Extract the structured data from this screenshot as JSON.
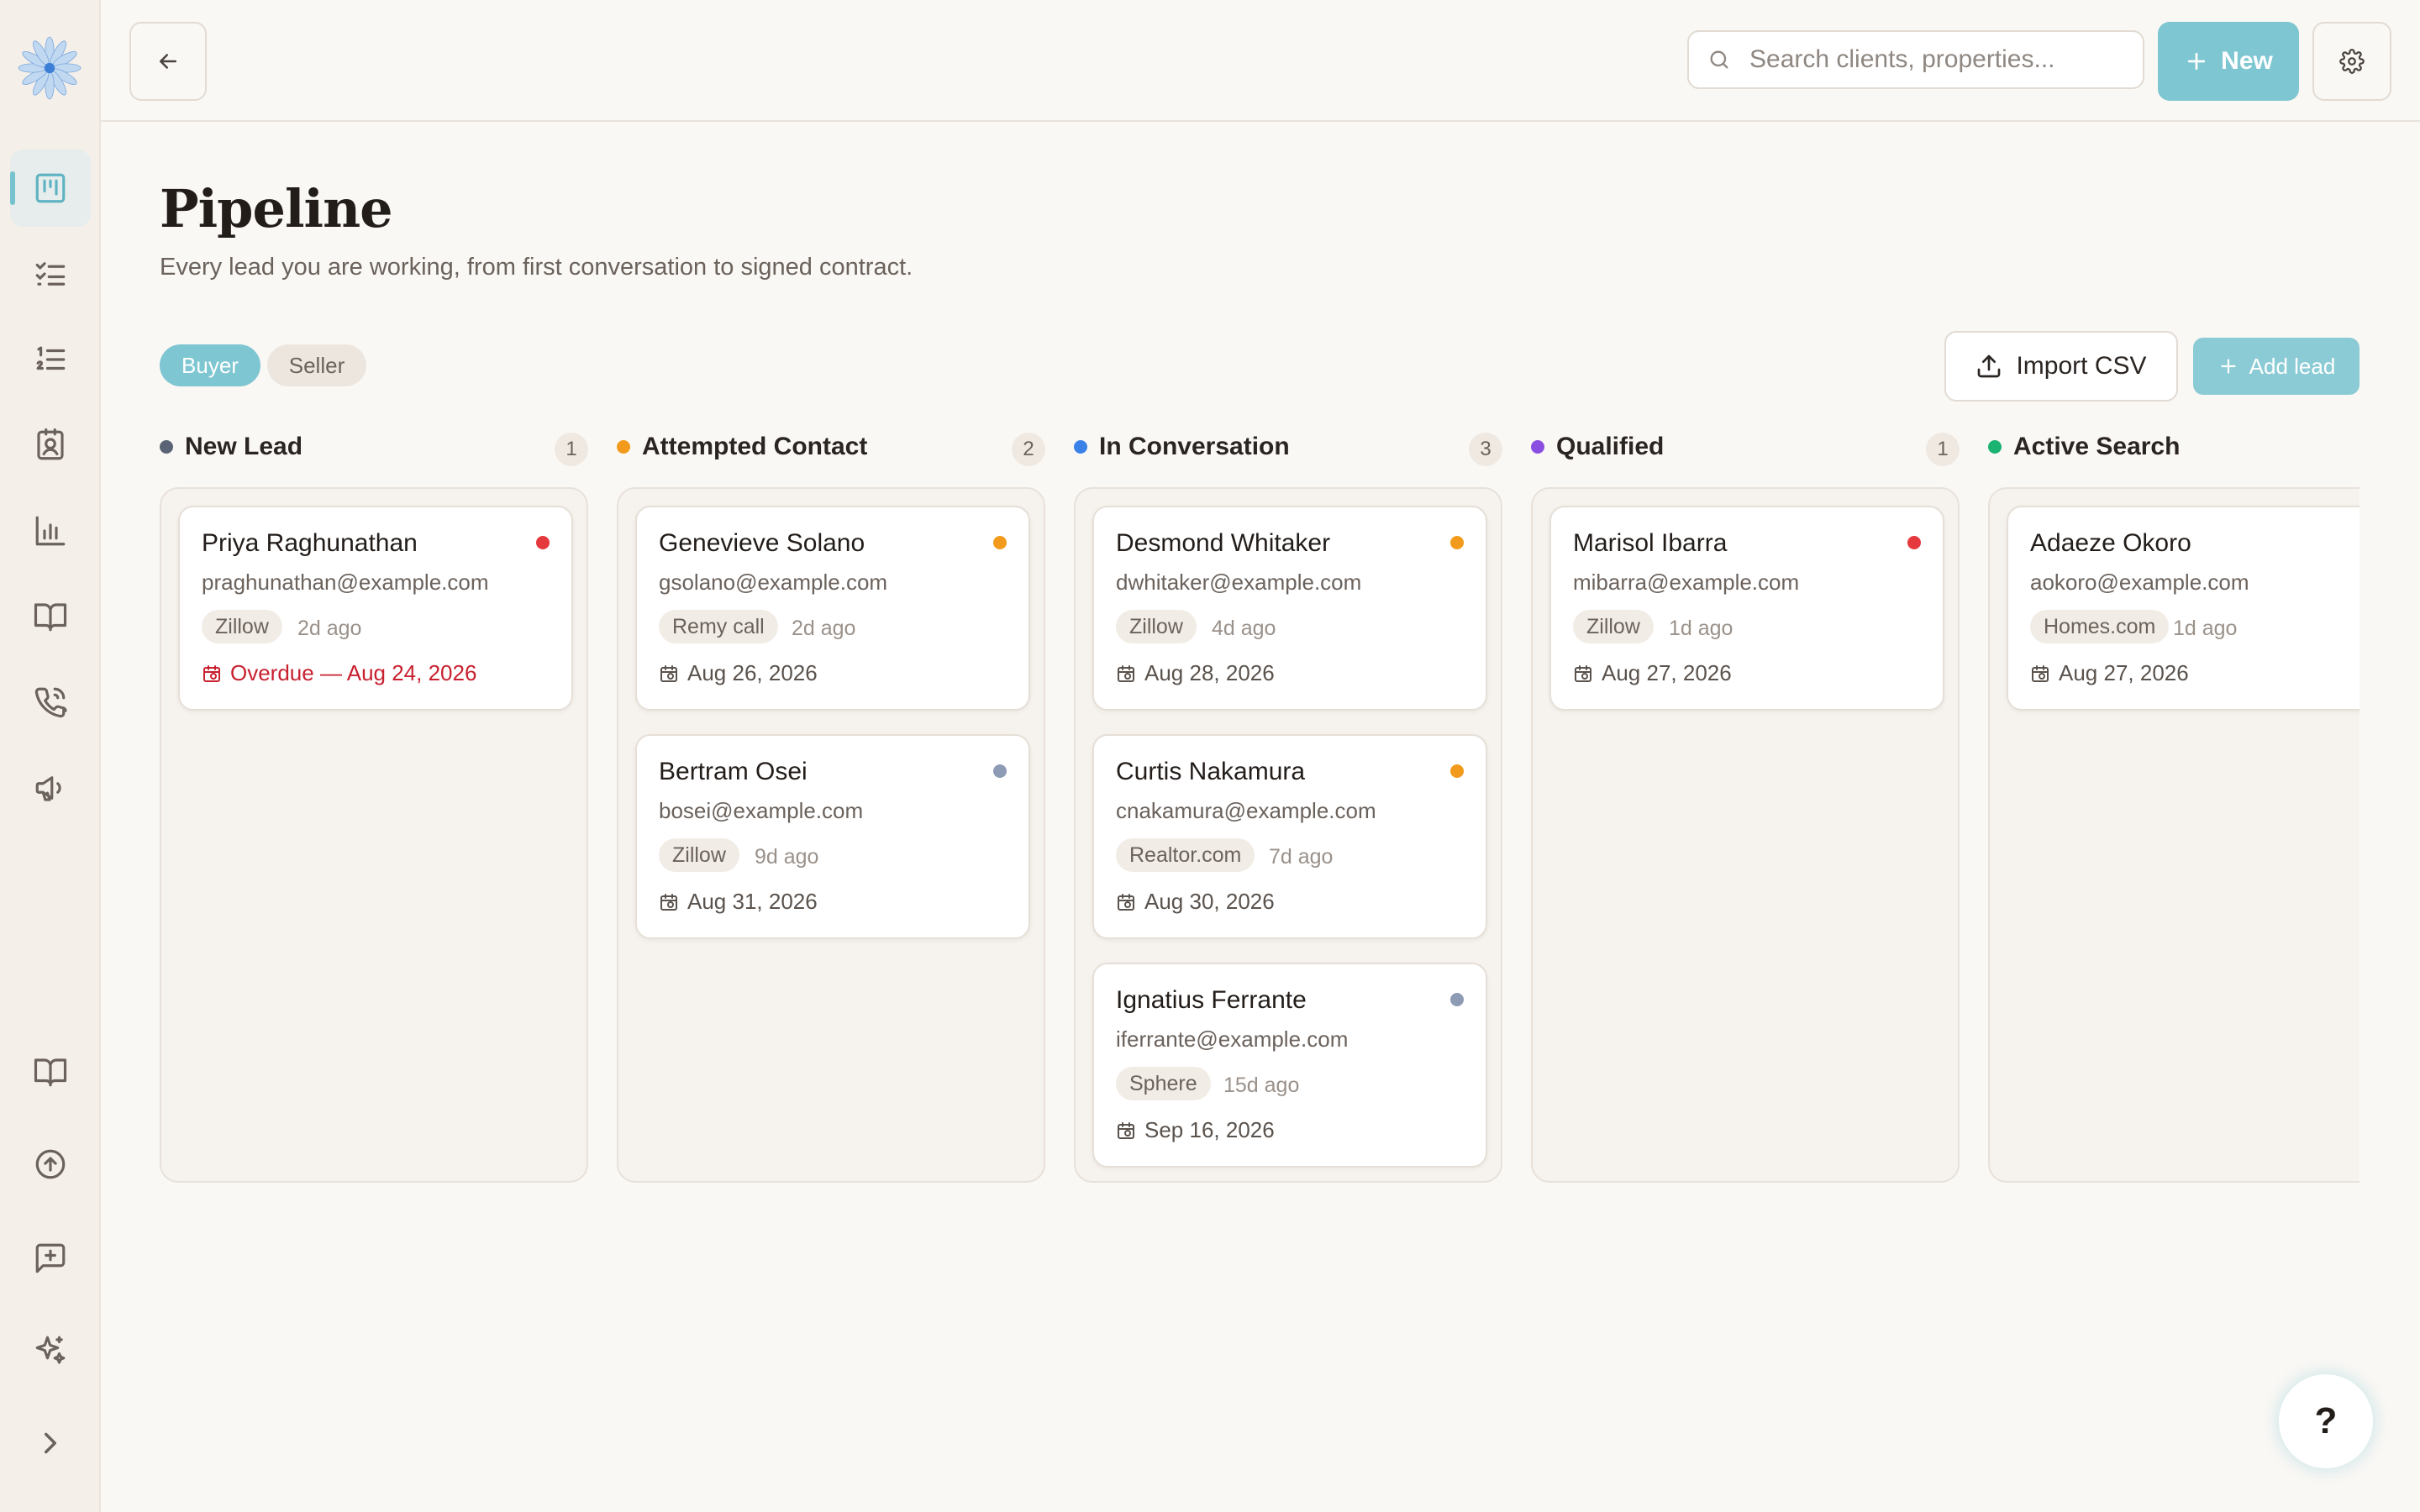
{
  "search": {
    "placeholder": "Search clients, properties..."
  },
  "header": {
    "new_label": "New"
  },
  "page": {
    "title": "Pipeline",
    "subtitle": "Every lead you are working, from first conversation to signed contract."
  },
  "filters": {
    "buyer": "Buyer",
    "seller": "Seller",
    "active": "Buyer"
  },
  "actions": {
    "import_label": "Import CSV",
    "add_lead_label": "Add lead"
  },
  "columns": [
    {
      "name": "New Lead",
      "count": "1",
      "color": "#5b6475",
      "cards": [
        {
          "name": "Priya Raghunathan",
          "email": "praghunathan@example.com",
          "source": "Zillow",
          "ago": "2d ago",
          "date": "Overdue — Aug 24, 2026",
          "overdue": true,
          "dot": "#e5393d"
        }
      ]
    },
    {
      "name": "Attempted Contact",
      "count": "2",
      "color": "#f29a1b",
      "cards": [
        {
          "name": "Genevieve Solano",
          "email": "gsolano@example.com",
          "source": "Remy call",
          "ago": "2d ago",
          "date": "Aug 26, 2026",
          "overdue": false,
          "dot": "#f29a1b"
        },
        {
          "name": "Bertram Osei",
          "email": "bosei@example.com",
          "source": "Zillow",
          "ago": "9d ago",
          "date": "Aug 31, 2026",
          "overdue": false,
          "dot": "#8e9bb5"
        }
      ]
    },
    {
      "name": "In Conversation",
      "count": "3",
      "color": "#3b82e8",
      "cards": [
        {
          "name": "Desmond Whitaker",
          "email": "dwhitaker@example.com",
          "source": "Zillow",
          "ago": "4d ago",
          "date": "Aug 28, 2026",
          "overdue": false,
          "dot": "#f29a1b"
        },
        {
          "name": "Curtis Nakamura",
          "email": "cnakamura@example.com",
          "source": "Realtor.com",
          "ago": "7d ago",
          "date": "Aug 30, 2026",
          "overdue": false,
          "dot": "#f29a1b"
        },
        {
          "name": "Ignatius Ferrante",
          "email": "iferrante@example.com",
          "source": "Sphere",
          "ago": "15d ago",
          "date": "Sep 16, 2026",
          "overdue": false,
          "dot": "#8e9bb5"
        }
      ]
    },
    {
      "name": "Qualified",
      "count": "1",
      "color": "#8a4fe0",
      "cards": [
        {
          "name": "Marisol Ibarra",
          "email": "mibarra@example.com",
          "source": "Zillow",
          "ago": "1d ago",
          "date": "Aug 27, 2026",
          "overdue": false,
          "dot": "#e5393d"
        }
      ]
    },
    {
      "name": "Active Search",
      "count": "",
      "color": "#1bb372",
      "cards": [
        {
          "name": "Adaeze Okoro",
          "email": "aokoro@example.com",
          "source": "Homes.com",
          "ago": "1d ago",
          "date": "Aug 27, 2026",
          "overdue": false,
          "dot": ""
        }
      ]
    }
  ],
  "help": {
    "label": "?"
  },
  "icons": [
    "logo-flower-icon",
    "pipeline-board-icon",
    "checklist-icon",
    "numbered-list-icon",
    "contact-card-icon",
    "bar-chart-icon",
    "book-icon",
    "phone-icon",
    "megaphone-icon",
    "book-icon",
    "upload-circle-icon",
    "message-plus-icon",
    "sparkles-icon",
    "chevron-right-icon",
    "back-arrow-icon",
    "search-icon",
    "plus-icon",
    "gear-icon",
    "upload-icon",
    "calendar-icon"
  ]
}
